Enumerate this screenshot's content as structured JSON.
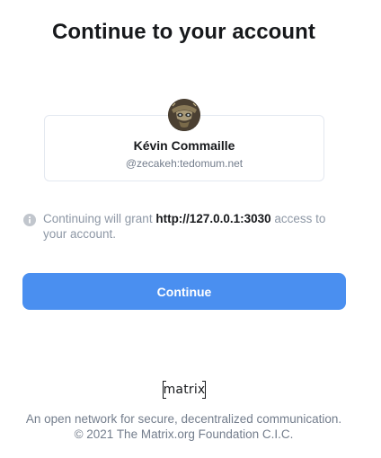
{
  "header": {
    "title": "Continue to your account"
  },
  "account": {
    "display_name": "Kévin Commaille",
    "user_id": "@zecakeh:tedomum.net",
    "avatar_icon": "user-avatar-image"
  },
  "consent": {
    "text_before": "Continuing will grant ",
    "client": "http://127.0.0.1:3030",
    "text_after": " access to your account.",
    "icon": "info-icon"
  },
  "actions": {
    "continue_label": "Continue"
  },
  "footer": {
    "logo_text": "matrix",
    "tagline": "An open network for secure, decentralized communication.",
    "copyright": "© 2021 The Matrix.org Foundation C.I.C."
  },
  "colors": {
    "accent": "#4a8ff0",
    "text_primary": "#17191c",
    "text_muted": "#737d8c",
    "border": "#e3e8f0"
  }
}
